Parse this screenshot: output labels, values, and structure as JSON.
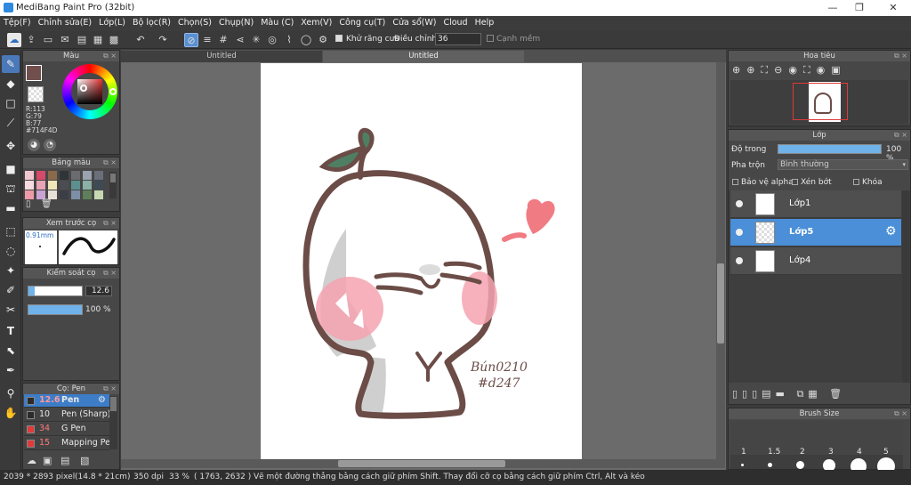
{
  "titlebar": {
    "title": "MediBang Paint Pro (32bit)",
    "minimize": "—",
    "maximize": "❐",
    "close": "✕"
  },
  "menu": [
    "Tệp(F)",
    "Chỉnh sửa(E)",
    "Lớp(L)",
    "Bộ lọc(R)",
    "Chọn(S)",
    "Chụp(N)",
    "Màu (C)",
    "Xem(V)",
    "Công cụ(T)",
    "Cửa sổ(W)",
    "Cloud",
    "Help"
  ],
  "toolbar": {
    "antialias_label": "Khử răng cưa",
    "adjust_label": "Điều chỉnh",
    "adjust_value": "36",
    "edge_label": "Cạnh mềm"
  },
  "color_panel": {
    "title": "Màu",
    "r": "R:113",
    "g": "G:79",
    "b": "B:77",
    "hex": "#714F4D",
    "main_color": "#714f4d"
  },
  "palette_panel": {
    "title": "Bảng màu",
    "swatches": [
      "#f2c6cf",
      "#d54a6a",
      "#8a6a4a",
      "#2f3438",
      "#6b6c70",
      "#9ba2b0",
      "#6a6f7a",
      "#f7dbe0",
      "#e8a3b4",
      "#f0e7b8",
      "#4b4d52",
      "#5d8f8f",
      "#8ab0a8",
      "#3f4a57",
      "#ee9aa9",
      "#c9a3d4",
      "#e7e1d8",
      "#3b3e46",
      "#7c8fa6",
      "#5e7f5a",
      "#c6d9b0"
    ]
  },
  "preview_panel": {
    "title": "Xem trước cọ",
    "size_label": "0.91mm"
  },
  "control_panel": {
    "title": "Kiểm soát cọ",
    "size_value": "12.6",
    "opacity_value": "100 %",
    "size_fraction": 0.12,
    "opacity_fraction": 1.0
  },
  "brush_panel": {
    "title": "Cọ: Pen",
    "brushes": [
      {
        "size": "12.6",
        "name": "Pen",
        "color": "#2b2b2b",
        "selected": true
      },
      {
        "size": "10",
        "name": "Pen (Sharp)",
        "color": "#2b2b2b",
        "selected": false
      },
      {
        "size": "34",
        "name": "G Pen",
        "color": "#e03a3a",
        "selected": false
      },
      {
        "size": "15",
        "name": "Mapping Pen",
        "color": "#e03a3a",
        "selected": false
      }
    ]
  },
  "tabs": [
    {
      "label": "Untitled",
      "active": false
    },
    {
      "label": "Untitled",
      "active": true
    }
  ],
  "canvas_text": {
    "signature_line1": "Bún0210",
    "signature_line2": "#d247"
  },
  "navigator_panel": {
    "title": "Hoa tiêu"
  },
  "layer_panel": {
    "title": "Lớp",
    "opacity_label": "Độ trong",
    "opacity_value": "100 %",
    "opacity_fraction": 1.0,
    "blend_label": "Pha trộn",
    "blend_value": "Bình thường",
    "protect_alpha": "Bảo vệ alpha",
    "clipping": "Xén bớt",
    "lock": "Khóa",
    "layers": [
      {
        "name": "Lớp1",
        "selected": false
      },
      {
        "name": "Lớp5",
        "selected": true
      },
      {
        "name": "Lớp4",
        "selected": false
      }
    ]
  },
  "brushsize_panel": {
    "title": "Brush Size",
    "sizes_row1": [
      "1",
      "1.5",
      "2",
      "3",
      "4",
      "5"
    ]
  },
  "status": {
    "dimensions": "2039 * 2893 pixel",
    "physical": "(14.8 * 21cm)",
    "dpi": "350 dpi",
    "zoom": "33 %",
    "coords": "( 1763, 2632 )",
    "hint": "Vẽ một đường thẳng bằng cách giữ phím Shift. Thay đổi cỡ cọ bằng cách giữ phím Ctrl, Alt và kéo"
  }
}
